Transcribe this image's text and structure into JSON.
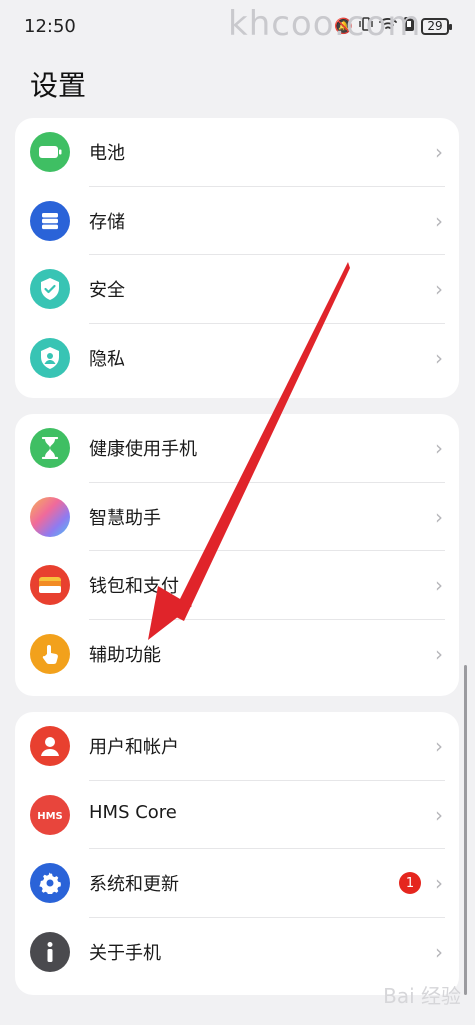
{
  "status_bar": {
    "time": "12:50",
    "battery": "29"
  },
  "watermark_top": "khcoo.com",
  "watermark_bottom": "Bai 经验",
  "page_title": "设置",
  "colors": {
    "arrow": "#e0242a",
    "badge": "#e5261e",
    "chevron": "#b6b6ba"
  },
  "groups": [
    {
      "items": [
        {
          "label": "电池",
          "icon": "battery-icon",
          "color": "#3fbf63"
        },
        {
          "label": "存储",
          "icon": "storage-icon",
          "color": "#2a63d8"
        },
        {
          "label": "安全",
          "icon": "shield-check-icon",
          "color": "#38c4b4"
        },
        {
          "label": "隐私",
          "icon": "privacy-shield-icon",
          "color": "#38c4b4"
        }
      ]
    },
    {
      "items": [
        {
          "label": "健康使用手机",
          "icon": "hourglass-icon",
          "color": "#3fbf63"
        },
        {
          "label": "智慧助手",
          "icon": "assistant-orb-icon",
          "color": "gradient"
        },
        {
          "label": "钱包和支付",
          "icon": "wallet-icon",
          "color": "#e8402f"
        },
        {
          "label": "辅助功能",
          "icon": "hand-touch-icon",
          "color": "#f2a11c"
        }
      ]
    },
    {
      "items": [
        {
          "label": "用户和帐户",
          "icon": "user-icon",
          "color": "#e8402f"
        },
        {
          "label": "HMS Core",
          "icon": "hms-icon",
          "color": "#e8453c"
        },
        {
          "label": "系统和更新",
          "icon": "gear-icon",
          "color": "#2a63d8",
          "badge": "1"
        },
        {
          "label": "关于手机",
          "icon": "info-icon",
          "color": "#4a4a4e"
        }
      ]
    }
  ]
}
